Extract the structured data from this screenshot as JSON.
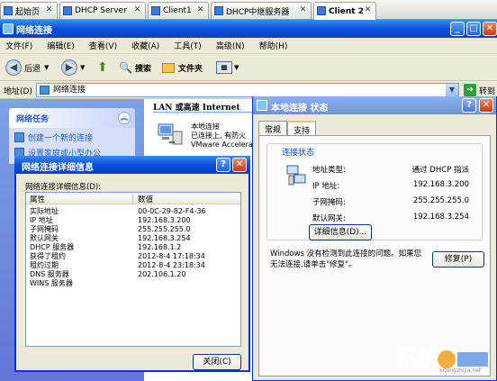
{
  "tabs": [
    {
      "label": "起始页"
    },
    {
      "label": "DHCP Server"
    },
    {
      "label": "Client1"
    },
    {
      "label": "DHCP中继服务器"
    },
    {
      "label": "Client 2"
    }
  ],
  "window": {
    "title": "网络连接",
    "menu": [
      "文件(F)",
      "编辑(E)",
      "查看(V)",
      "收藏(A)",
      "工具(T)",
      "高级(N)",
      "帮助(H)"
    ],
    "toolbar": {
      "back": "后退",
      "search": "搜索",
      "folders": "文件夹"
    },
    "address": {
      "label": "地址(D)",
      "value": "网络连接",
      "go": "转到"
    }
  },
  "left_pane": {
    "section_title": "网络任务",
    "tasks": [
      "创建一个新的连接",
      "设置家庭或小型办公"
    ]
  },
  "main_pane": {
    "section_header": "LAN 或高速 Internet",
    "connection": {
      "name": "本地连接",
      "status": "已连接上, 有防火",
      "adapter": "VMware Accelera"
    }
  },
  "status_dialog": {
    "title": "本地连接 状态",
    "tabs": [
      "常规",
      "支持"
    ],
    "group_label": "连接状态",
    "fields": [
      {
        "label": "地址类型:",
        "value": "通过 DHCP 指派"
      },
      {
        "label": "IP 地址:",
        "value": "192.168.3.200"
      },
      {
        "label": "子网掩码:",
        "value": "255.255.255.0"
      },
      {
        "label": "默认网关:",
        "value": "192.168.3.254"
      }
    ],
    "details_button": "详细信息(D)...",
    "message": "Windows 没有检测到此连接的问题。如果您无法连接,请单击\"修复\"。",
    "repair_button": "修复(P)"
  },
  "details_dialog": {
    "title": "网络连接详细信息",
    "list_label": "网络连接详细信息(D):",
    "columns": [
      "属性",
      "数值"
    ],
    "rows": [
      {
        "property": "实际地址",
        "value": "00-0C-29-82-F4-36"
      },
      {
        "property": "IP 地址",
        "value": "192.168.3.200"
      },
      {
        "property": "子网掩码",
        "value": "255.255.255.0"
      },
      {
        "property": "默认网关",
        "value": "192.168.3.254"
      },
      {
        "property": "DHCP 服务器",
        "value": "192.168.1.2"
      },
      {
        "property": "获得了租约",
        "value": "2012-8-4 17:18:34"
      },
      {
        "property": "租约过期",
        "value": "2012-8-4 23:18:34"
      },
      {
        "property": "DNS 服务器",
        "value": "202.106.1.20"
      },
      {
        "property": "WINS 服务器",
        "value": ""
      }
    ],
    "close_button": "关闭(C)"
  },
  "watermark": {
    "text": "系统",
    "url": "xitongzhijia.net"
  }
}
